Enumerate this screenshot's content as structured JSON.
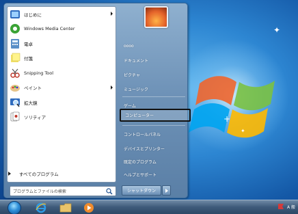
{
  "start_menu": {
    "programs": [
      {
        "label": "はじめに",
        "icon": "getting-started-icon",
        "has_arrow": true
      },
      {
        "label": "Windows Media Center",
        "icon": "media-center-icon",
        "has_arrow": false
      },
      {
        "label": "電卓",
        "icon": "calculator-icon",
        "has_arrow": false
      },
      {
        "label": "付箋",
        "icon": "sticky-notes-icon",
        "has_arrow": false
      },
      {
        "label": "Snipping Tool",
        "icon": "snipping-tool-icon",
        "has_arrow": false
      },
      {
        "label": "ペイント",
        "icon": "paint-icon",
        "has_arrow": true
      },
      {
        "label": "拡大鏡",
        "icon": "magnifier-icon",
        "has_arrow": false
      },
      {
        "label": "ソリティア",
        "icon": "solitaire-icon",
        "has_arrow": false
      }
    ],
    "all_programs_label": "すべてのプログラム",
    "search_placeholder": "プログラムとファイルの検索",
    "right_items": [
      {
        "label": "oooo"
      },
      {
        "label": "ドキュメント"
      },
      {
        "label": "ピクチャ"
      },
      {
        "label": "ミュージック"
      },
      {
        "label": "ゲーム"
      },
      {
        "label": "コンピューター"
      },
      {
        "label": "コントロールパネル"
      },
      {
        "label": "デバイスとプリンター"
      },
      {
        "label": "既定のプログラム"
      },
      {
        "label": "ヘルプとサポート"
      }
    ],
    "shutdown_label": "シャットダウン"
  },
  "taskbar": {
    "pinned": [
      "start-orb",
      "internet-explorer-icon",
      "explorer-folder-icon",
      "media-player-icon"
    ],
    "tray_text": "A 般"
  },
  "colors": {
    "accent": "#2d86d2",
    "highlight_border": "#111111",
    "menu_right_pane": "#6f93b8"
  }
}
